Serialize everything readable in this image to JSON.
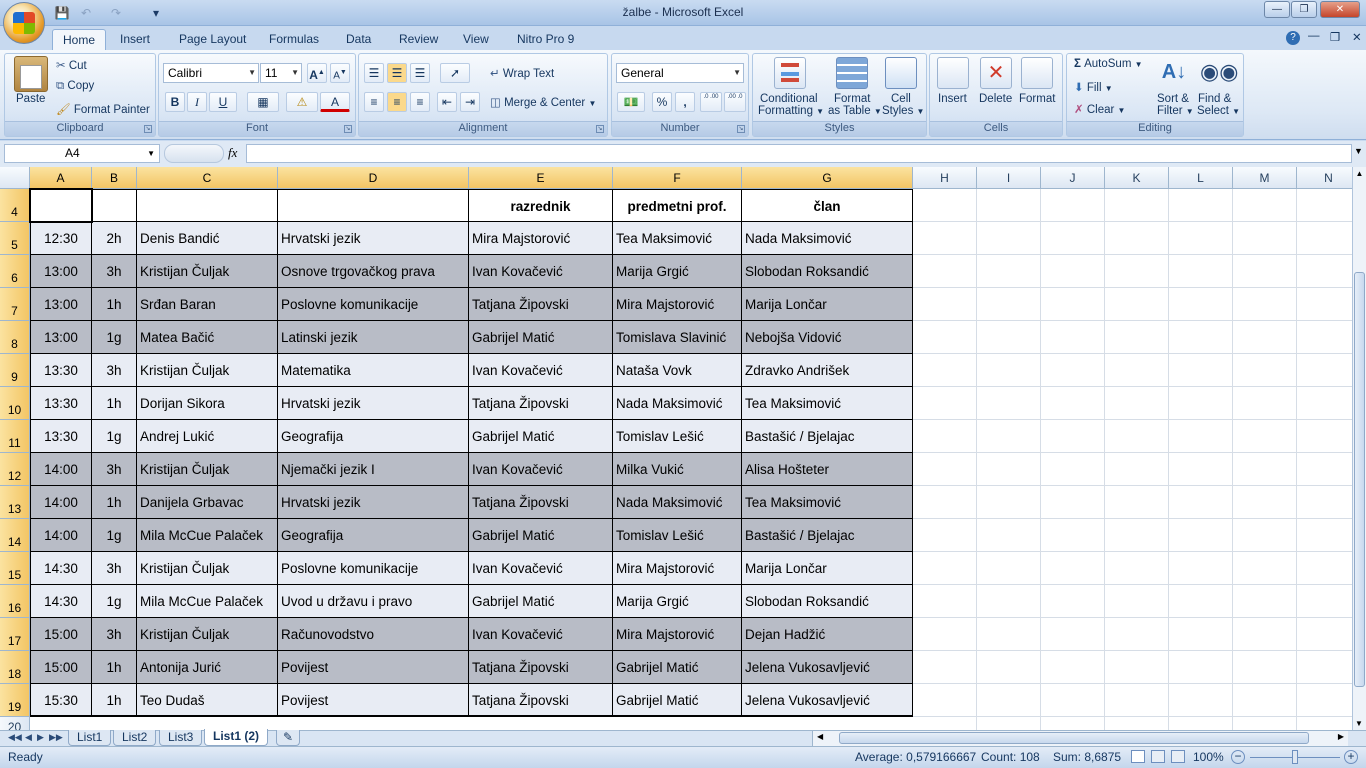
{
  "window": {
    "title": "žalbe - Microsoft Excel"
  },
  "ribbon_tabs": [
    "Home",
    "Insert",
    "Page Layout",
    "Formulas",
    "Data",
    "Review",
    "View",
    "Nitro Pro 9"
  ],
  "clipboard": {
    "paste": "Paste",
    "cut": "Cut",
    "copy": "Copy",
    "format_painter": "Format Painter",
    "label": "Clipboard"
  },
  "font": {
    "name": "Calibri",
    "size": "11",
    "bold": "B",
    "italic": "I",
    "underline": "U",
    "label": "Font"
  },
  "alignment": {
    "wrap_text": "Wrap Text",
    "merge_center": "Merge & Center",
    "label": "Alignment"
  },
  "number": {
    "format": "General",
    "percent": "%",
    "comma": ",",
    "inc_dec": ".0 .00",
    "dec_dec": ".00 .0",
    "label": "Number"
  },
  "styles": {
    "conditional": "Conditional",
    "conditional2": "Formatting",
    "format_table": "Format",
    "format_table2": "as Table",
    "cell_styles": "Cell",
    "cell_styles2": "Styles",
    "label": "Styles"
  },
  "cells": {
    "insert": "Insert",
    "delete": "Delete",
    "format": "Format",
    "label": "Cells"
  },
  "editing": {
    "autosum": "AutoSum",
    "fill": "Fill",
    "clear": "Clear",
    "sort": "Sort &",
    "sort2": "Filter",
    "find": "Find &",
    "find2": "Select",
    "label": "Editing"
  },
  "formula_bar": {
    "name_box": "A4",
    "fx": "fx",
    "formula": ""
  },
  "columns": [
    "A",
    "B",
    "C",
    "D",
    "E",
    "F",
    "G",
    "H",
    "I",
    "J",
    "K",
    "L",
    "M",
    "N"
  ],
  "header_row": {
    "row": "4",
    "cells": [
      "",
      "",
      "",
      "",
      "razrednik",
      "predmetni prof.",
      "član"
    ]
  },
  "rows": [
    {
      "row": "5",
      "cells": [
        "12:30",
        "2h",
        "Denis Bandić",
        "Hrvatski jezik",
        "Mira Majstorović",
        "Tea Maksimović",
        "Nada Maksimović"
      ]
    },
    {
      "row": "6",
      "cells": [
        "13:00",
        "3h",
        "Kristijan Čuljak",
        "Osnove trgovačkog prava",
        "Ivan Kovačević",
        "Marija Grgić",
        "Slobodan Roksandić"
      ]
    },
    {
      "row": "7",
      "cells": [
        "13:00",
        "1h",
        "Srđan Baran",
        "Poslovne komunikacije",
        "Tatjana Žipovski",
        "Mira Majstorović",
        "Marija Lončar"
      ]
    },
    {
      "row": "8",
      "cells": [
        "13:00",
        "1g",
        "Matea Bačić",
        "Latinski jezik",
        "Gabrijel Matić",
        "Tomislava Slavinić",
        "Nebojša Vidović"
      ]
    },
    {
      "row": "9",
      "cells": [
        "13:30",
        "3h",
        "Kristijan Čuljak",
        "Matematika",
        "Ivan Kovačević",
        "Nataša Vovk",
        "Zdravko Andrišek"
      ]
    },
    {
      "row": "10",
      "cells": [
        "13:30",
        "1h",
        "Dorijan Sikora",
        "Hrvatski jezik",
        "Tatjana Žipovski",
        "Nada Maksimović",
        "Tea Maksimović"
      ]
    },
    {
      "row": "11",
      "cells": [
        "13:30",
        "1g",
        "Andrej Lukić",
        "Geografija",
        "Gabrijel Matić",
        "Tomislav Lešić",
        "Bastašić / Bjelajac"
      ]
    },
    {
      "row": "12",
      "cells": [
        "14:00",
        "3h",
        "Kristijan Čuljak",
        "Njemački jezik I",
        "Ivan Kovačević",
        "Milka Vukić",
        "Alisa Hošteter"
      ]
    },
    {
      "row": "13",
      "cells": [
        "14:00",
        "1h",
        "Danijela Grbavac",
        "Hrvatski jezik",
        "Tatjana Žipovski",
        "Nada Maksimović",
        "Tea Maksimović"
      ]
    },
    {
      "row": "14",
      "cells": [
        "14:00",
        "1g",
        "Mila McCue Palaček",
        "Geografija",
        "Gabrijel Matić",
        "Tomislav Lešić",
        "Bastašić / Bjelajac"
      ]
    },
    {
      "row": "15",
      "cells": [
        "14:30",
        "3h",
        "Kristijan Čuljak",
        "Poslovne komunikacije",
        "Ivan Kovačević",
        "Mira Majstorović",
        "Marija Lončar"
      ]
    },
    {
      "row": "16",
      "cells": [
        "14:30",
        "1g",
        "Mila McCue Palaček",
        "Uvod u državu i pravo",
        "Gabrijel Matić",
        "Marija Grgić",
        "Slobodan Roksandić"
      ]
    },
    {
      "row": "17",
      "cells": [
        "15:00",
        "3h",
        "Kristijan Čuljak",
        "Računovodstvo",
        "Ivan Kovačević",
        "Mira Majstorović",
        "Dejan Hadžić"
      ]
    },
    {
      "row": "18",
      "cells": [
        "15:00",
        "1h",
        "Antonija Jurić",
        "Povijest",
        "Tatjana Žipovski",
        "Gabrijel Matić",
        "Jelena Vukosavljević"
      ]
    },
    {
      "row": "19",
      "cells": [
        "15:30",
        "1h",
        "Teo Dudaš",
        "Povijest",
        "Tatjana Žipovski",
        "Gabrijel Matić",
        "Jelena Vukosavljević"
      ]
    }
  ],
  "last_row": "20",
  "row_shading": [
    "light",
    "dark",
    "dark",
    "dark",
    "light",
    "light",
    "light",
    "dark",
    "dark",
    "dark",
    "light",
    "light",
    "dark",
    "dark",
    "light"
  ],
  "sheet_tabs": [
    "List1",
    "List2",
    "List3",
    "List1 (2)"
  ],
  "active_sheet": "List1 (2)",
  "status": {
    "ready": "Ready",
    "average": "Average: 0,579166667",
    "count": "Count: 108",
    "sum": "Sum: 8,6875",
    "zoom": "100%"
  },
  "colors": {
    "header_highlight": "#f3c565",
    "row_light": "#e8ecf4",
    "row_dark": "#b8bcc6",
    "ribbon": "#dde8f5"
  }
}
